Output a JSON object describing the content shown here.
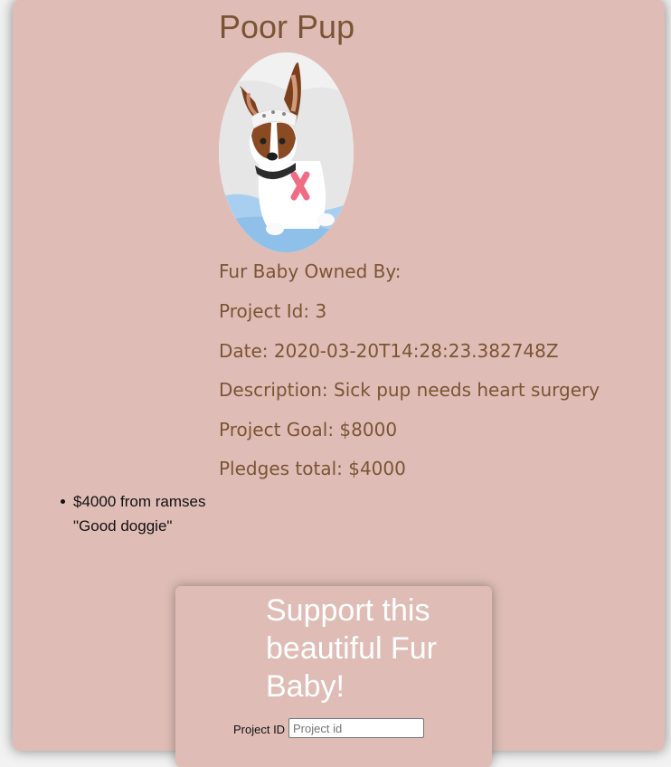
{
  "project": {
    "title": "Poor Pup",
    "image_alt": "Sick puppy in a bandage lying in bed",
    "owner_line": "Fur Baby Owned By:",
    "id_line": "Project Id: 3",
    "date_line": "Date: 2020-03-20T14:28:23.382748Z",
    "description_line": "Description: Sick pup needs heart surgery",
    "goal_line": "Project Goal: $8000",
    "pledges_total_line": "Pledges total: $4000"
  },
  "pledges": [
    {
      "amount_line": "$4000 from ramses",
      "comment": "\"Good doggie\""
    }
  ],
  "support_form": {
    "heading": "Support this beautiful Fur Baby!",
    "project_id_label": "Project ID",
    "project_id_placeholder": "Project id",
    "project_id_value": ""
  },
  "colors": {
    "card_background": "#dfbdb6",
    "heading_brown": "#7a5434",
    "support_heading": "#ffffff"
  }
}
